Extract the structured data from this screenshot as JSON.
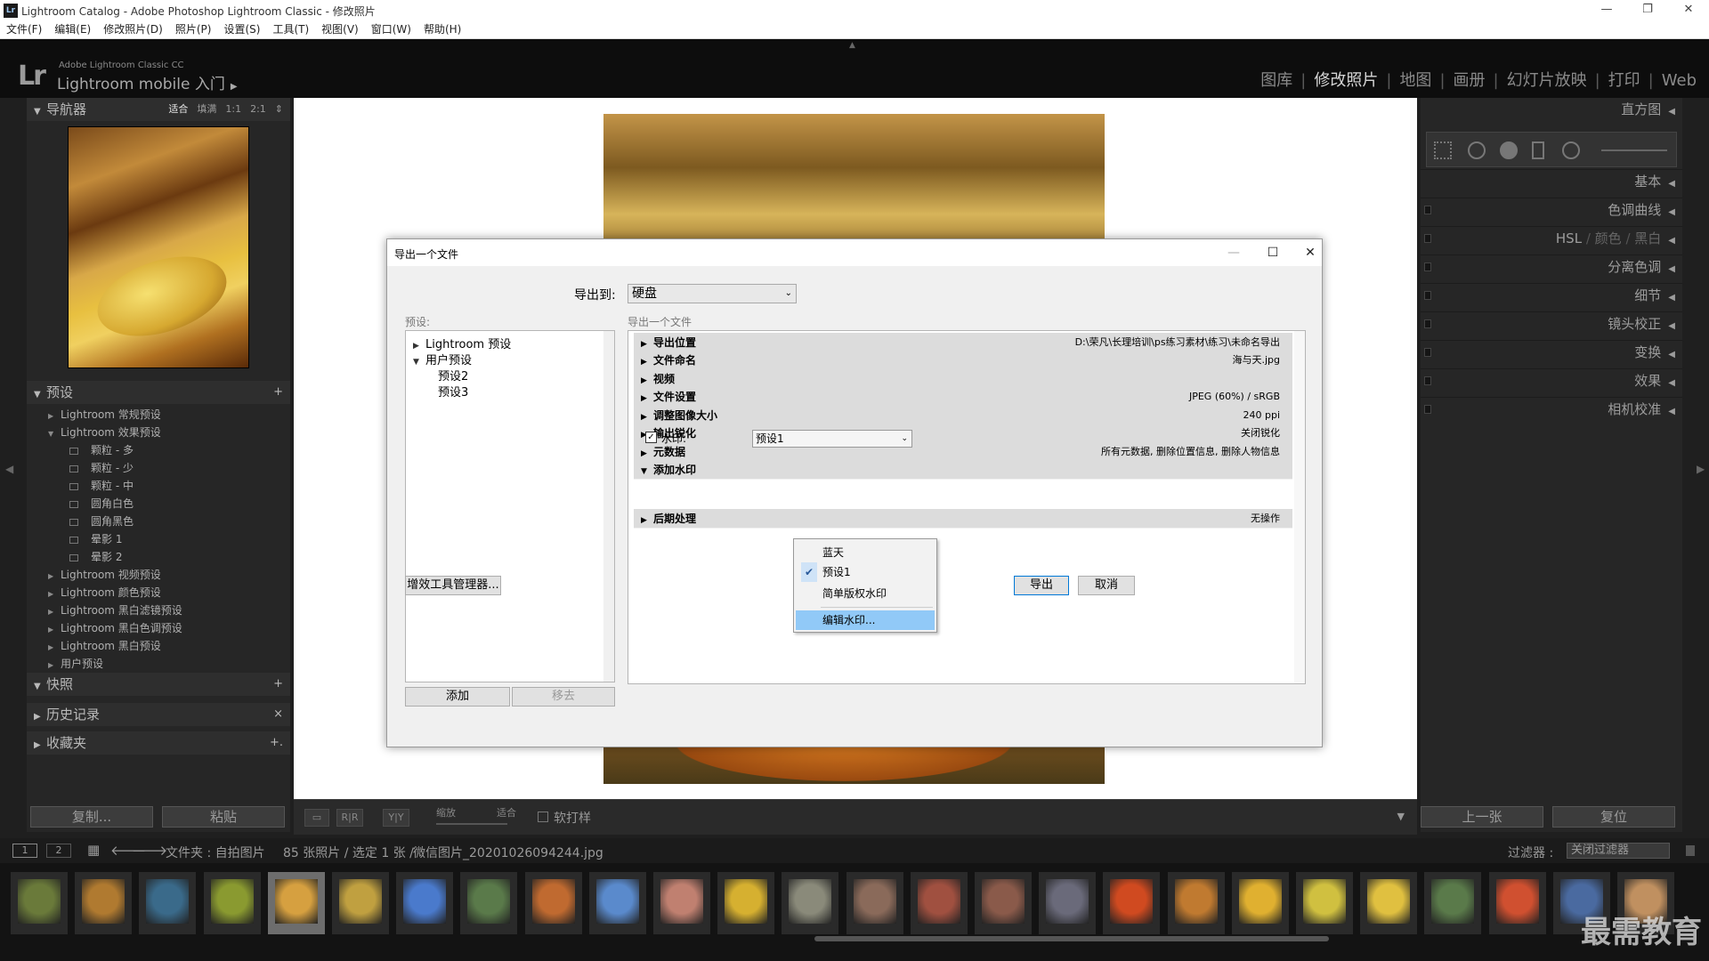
{
  "window": {
    "title": "Lightroom Catalog - Adobe Photoshop Lightroom Classic - 修改照片",
    "app_icon": "Lr"
  },
  "menu": [
    "文件(F)",
    "编辑(E)",
    "修改照片(D)",
    "照片(P)",
    "设置(S)",
    "工具(T)",
    "视图(V)",
    "窗口(W)",
    "帮助(H)"
  ],
  "header": {
    "logo": "Lr",
    "product": "Adobe Lightroom Classic CC",
    "mobile": "Lightroom mobile 入门",
    "modules": [
      "图库",
      "修改照片",
      "地图",
      "画册",
      "幻灯片放映",
      "打印",
      "Web"
    ],
    "active_module": "修改照片"
  },
  "navigator": {
    "title": "导航器",
    "sizes": [
      "适合",
      "填满",
      "1:1",
      "2:1"
    ]
  },
  "presets": {
    "title": "预设",
    "add": "+",
    "groups": [
      {
        "label": "Lightroom 常规预设",
        "expanded": false
      },
      {
        "label": "Lightroom 效果预设",
        "expanded": true
      },
      {
        "label": "颗粒 - 多",
        "child": true
      },
      {
        "label": "颗粒 - 少",
        "child": true
      },
      {
        "label": "颗粒 - 中",
        "child": true
      },
      {
        "label": "圆角白色",
        "child": true
      },
      {
        "label": "圆角黑色",
        "child": true
      },
      {
        "label": "晕影 1",
        "child": true
      },
      {
        "label": "晕影 2",
        "child": true
      },
      {
        "label": "Lightroom 视频预设",
        "expanded": false
      },
      {
        "label": "Lightroom 颜色预设",
        "expanded": false
      },
      {
        "label": "Lightroom 黑白滤镜预设",
        "expanded": false
      },
      {
        "label": "Lightroom 黑白色调预设",
        "expanded": false
      },
      {
        "label": "Lightroom 黑白预设",
        "expanded": false
      },
      {
        "label": "用户预设",
        "expanded": false
      }
    ]
  },
  "left_panels": {
    "snapshots": "快照",
    "snapshots_btn": "+",
    "history": "历史记录",
    "history_btn": "×",
    "collections": "收藏夹",
    "collections_btn": "+."
  },
  "left_buttons": {
    "copy": "复制...",
    "paste": "粘贴"
  },
  "toolbar": {
    "zoom_label": "缩放",
    "zoom_value": "适合",
    "softproof": "软打样"
  },
  "right_panels": {
    "histogram": "直方图",
    "basic": "基本",
    "tone_curve": "色调曲线",
    "hsl": "HSL",
    "color": "颜色",
    "bw": "黑白",
    "split_toning": "分离色调",
    "detail": "细节",
    "lens": "镜头校正",
    "transform": "变换",
    "effects": "效果",
    "calibration": "相机校准"
  },
  "right_buttons": {
    "prev": "上一张",
    "reset": "复位"
  },
  "filmstrip": {
    "page1": "1",
    "page2": "2",
    "source": "文件夹 : 自拍图片",
    "count": "85 张照片 / 选定 1 张 /",
    "filename": "微信图片_20201026094244.jpg",
    "filter_label": "过滤器 :",
    "filter_value": "关闭过滤器",
    "thumb_colors": [
      "#6a7a3a",
      "#b07a30",
      "#3a6a8a",
      "#8a9a30",
      "#d6a040",
      "#c0a040",
      "#4a7acc",
      "#5a7a4a",
      "#c06a30",
      "#5a8acc",
      "#c08070",
      "#d6b030",
      "#8a8a7a",
      "#8a6a5a",
      "#a05040",
      "#8a5a4a",
      "#6a6a7a",
      "#d04a20",
      "#c07a30",
      "#e0b030",
      "#d0c040",
      "#e0c040",
      "#5a7a4a",
      "#d05030",
      "#4a6aa0",
      "#c09060"
    ],
    "selected_index": 4
  },
  "watermark": "最需教育",
  "dialog": {
    "title": "导出一个文件",
    "export_to_label": "导出到:",
    "export_to_value": "硬盘",
    "presets_label": "预设:",
    "subtitle": "导出一个文件",
    "preset_tree": [
      {
        "label": "Lightroom 预设",
        "level": 0,
        "expanded": false
      },
      {
        "label": "用户预设",
        "level": 0,
        "expanded": true
      },
      {
        "label": "预设2",
        "level": 1
      },
      {
        "label": "预设3",
        "level": 1
      }
    ],
    "add_btn": "添加",
    "remove_btn": "移去",
    "plugin_btn": "增效工具管理器...",
    "export_btn": "导出",
    "cancel_btn": "取消",
    "sections": [
      {
        "label": "导出位置",
        "value": "D:\\荣凡\\长理培训\\ps练习素材\\练习\\未命名导出"
      },
      {
        "label": "文件命名",
        "value": "海与天.jpg"
      },
      {
        "label": "视频",
        "value": ""
      },
      {
        "label": "文件设置",
        "value": "JPEG (60%) / sRGB"
      },
      {
        "label": "调整图像大小",
        "value": "240 ppi"
      },
      {
        "label": "输出锐化",
        "value": "关闭锐化"
      },
      {
        "label": "元数据",
        "value": "所有元数据, 删除位置信息, 删除人物信息"
      },
      {
        "label": "添加水印",
        "value": "",
        "expanded": true
      }
    ],
    "postprocess": {
      "label": "后期处理",
      "value": "无操作"
    },
    "watermark": {
      "label": "水印:",
      "checked": true,
      "selected": "预设1",
      "options": [
        "蓝天",
        "预设1",
        "简单版权水印",
        "编辑水印..."
      ]
    }
  }
}
